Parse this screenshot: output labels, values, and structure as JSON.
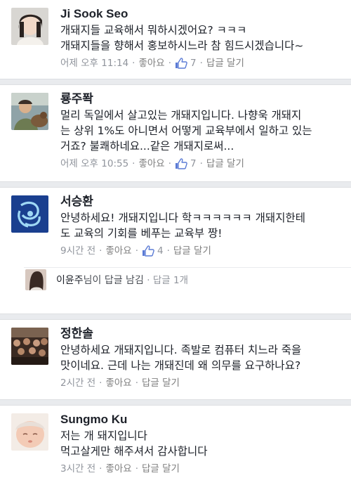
{
  "comments": [
    {
      "author": "Ji Sook Seo",
      "lines": [
        "개돼지들 교육해서 뭐하시겠어요? ㅋㅋㅋ",
        "개돼지들을 향해서 홍보하시느라 참 힘드시겠습니다~"
      ],
      "time": "어제 오후 11:14",
      "like_label": "좋아요",
      "like_count": "7",
      "reply_label": "답글 달기"
    },
    {
      "author": "룡주퐉",
      "lines": [
        "멀리 독일에서 살고있는 개돼지입니다. 나향욱 개돼지",
        "는 상위 1%도 아니면서 어떻게 교육부에서 일하고 있는",
        "거죠? 불쾌하네요...같은 개돼지로써..."
      ],
      "time": "어제 오후 10:55",
      "like_label": "좋아요",
      "like_count": "7",
      "reply_label": "답글 달기"
    },
    {
      "author": "서승환",
      "lines": [
        "안녕하세요! 개돼지입니다 학ㅋㅋㅋㅋㅋㅋ 개돼지한테",
        "도 교육의 기회를 베푸는 교육부 짱!"
      ],
      "time": "9시간 전",
      "like_label": "좋아요",
      "like_count": "4",
      "reply_label": "답글 달기"
    },
    {
      "author": "정한솔",
      "lines": [
        "안녕하세요 개돼지입니다. 족발로 컴퓨터 치느라 죽을",
        "맛이네요. 근데 나는 개돼진데 왜 의무를 요구하나요?"
      ],
      "time": "2시간 전",
      "like_label": "좋아요",
      "reply_label": "답글 달기"
    },
    {
      "author": "Sungmo Ku",
      "lines": [
        "저는 개 돼지입니다",
        "먹고살게만 해주셔서 감사합니다"
      ],
      "time": "3시간 전",
      "like_label": "좋아요",
      "reply_label": "답글 달기"
    }
  ],
  "reply_summary": {
    "name": "이윤주",
    "text": "님이 답글 남김",
    "count": "답글 1개"
  },
  "colors": {
    "text": "#1d2129",
    "meta": "#90949c",
    "like_blue": "#5b7bd5",
    "separator": "#e9ebee"
  }
}
